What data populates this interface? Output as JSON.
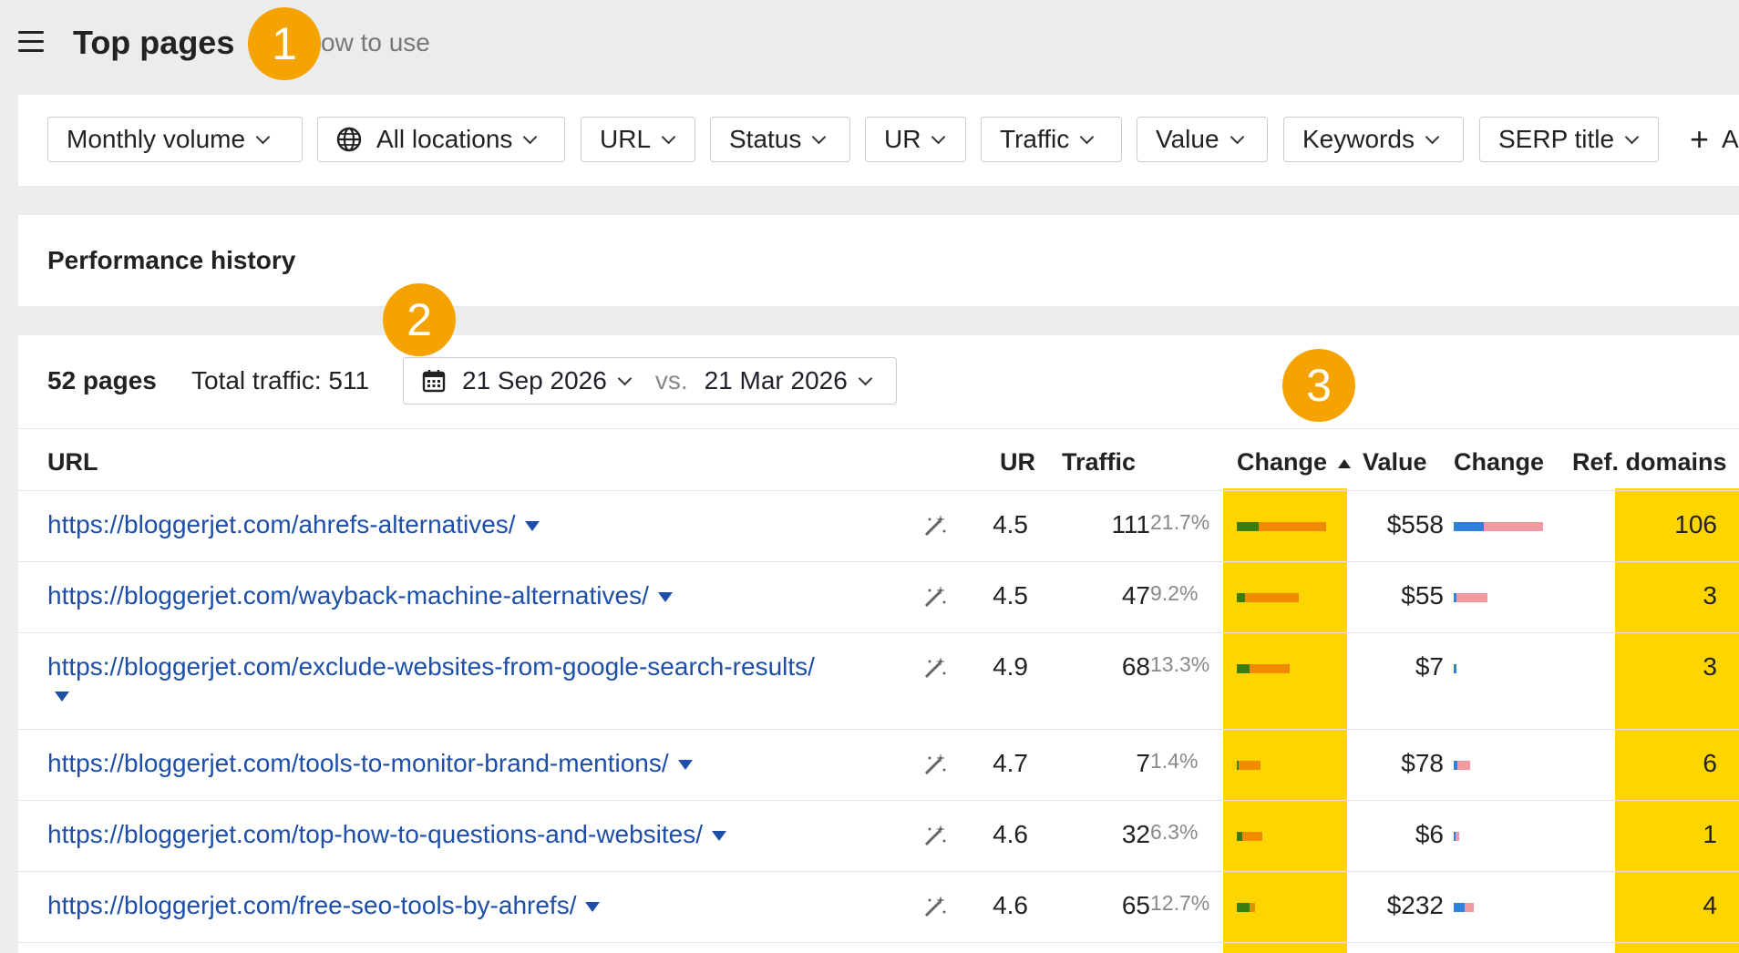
{
  "header": {
    "title": "Top pages",
    "how_to": "ow to use"
  },
  "badges": [
    "1",
    "2",
    "3"
  ],
  "filters": [
    "Monthly volume",
    "All locations",
    "URL",
    "Status",
    "UR",
    "Traffic",
    "Value",
    "Keywords",
    "SERP title"
  ],
  "add_filter": {
    "plus": "+",
    "label": "A"
  },
  "performance": {
    "title": "Performance history"
  },
  "summary": {
    "pages": "52 pages",
    "traffic": "Total traffic: 511"
  },
  "date": {
    "current": "21 Sep 2026",
    "vs": "vs.",
    "previous": "21 Mar 2026"
  },
  "columns": {
    "url": "URL",
    "ur": "UR",
    "traffic": "Traffic",
    "change": "Change",
    "value": "Value",
    "value_change": "Change",
    "ref_domains": "Ref. domains"
  },
  "sort": {
    "column": "change",
    "direction": "ascending"
  },
  "colors": {
    "accent_badge": "#f5a300",
    "highlight": "#ffd500",
    "link": "#1d4ea8",
    "bar_green": "#3a7d0c",
    "bar_orange": "#f28a00",
    "bar_blue": "#2f7fdc",
    "bar_pink": "#f19aa3"
  },
  "rows": [
    {
      "url": "https://bloggerjet.com/ahrefs-alternatives/",
      "ur": "4.5",
      "traffic": "111",
      "share": "21.7%",
      "value": "$558",
      "ref_domains": "106"
    },
    {
      "url": "https://bloggerjet.com/wayback-machine-alternatives/",
      "ur": "4.5",
      "traffic": "47",
      "share": "9.2%",
      "value": "$55",
      "ref_domains": "3"
    },
    {
      "url": "https://bloggerjet.com/exclude-websites-from-google-search-results/",
      "ur": "4.9",
      "traffic": "68",
      "share": "13.3%",
      "value": "$7",
      "ref_domains": "3"
    },
    {
      "url": "https://bloggerjet.com/tools-to-monitor-brand-mentions/",
      "ur": "4.7",
      "traffic": "7",
      "share": "1.4%",
      "value": "$78",
      "ref_domains": "6"
    },
    {
      "url": "https://bloggerjet.com/top-how-to-questions-and-websites/",
      "ur": "4.6",
      "traffic": "32",
      "share": "6.3%",
      "value": "$6",
      "ref_domains": "1"
    },
    {
      "url": "https://bloggerjet.com/free-seo-tools-by-ahrefs/",
      "ur": "4.6",
      "traffic": "65",
      "share": "12.7%",
      "value": "$232",
      "ref_domains": "4"
    }
  ]
}
